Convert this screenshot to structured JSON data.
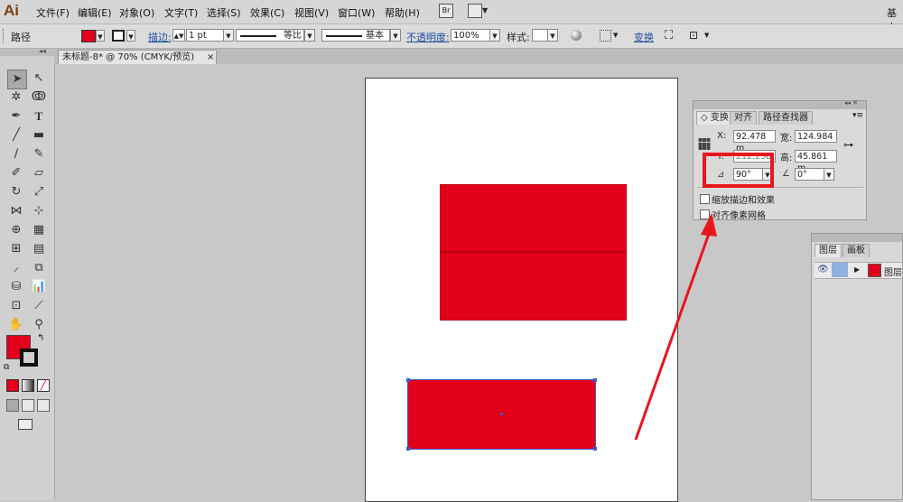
{
  "app": {
    "logo": "Ai"
  },
  "menu": {
    "items": [
      "文件(F)",
      "编辑(E)",
      "对象(O)",
      "文字(T)",
      "选择(S)",
      "效果(C)",
      "视图(V)",
      "窗口(W)",
      "帮助(H)"
    ],
    "bridge_label": "Br",
    "right_text": "基本"
  },
  "control": {
    "object_type": "路径",
    "fill_color": "#e3001b",
    "stroke_label": "描边:",
    "stroke_weight": "1 pt",
    "stroke_profile": "等比",
    "brush": "基本",
    "opacity_label": "不透明度:",
    "opacity_value": "100%",
    "style_label": "样式:",
    "transform_link": "变换"
  },
  "document": {
    "tab_title": "未标题-8* @ 70% (CMYK/预览)",
    "close": "×"
  },
  "canvas": {
    "artboard_color": "#ffffff",
    "shape_color": "#e3001b",
    "annotation_color": "#e8161d"
  },
  "transform_panel": {
    "tabs": [
      "变换",
      "对齐",
      "路径查找器"
    ],
    "x_label": "X:",
    "x_value": "92.478 m",
    "y_label": "Y:",
    "y_value": "212.258",
    "w_label": "宽:",
    "w_value": "124.984",
    "h_label": "高:",
    "h_value": "45.861 m",
    "rotate_value": "90°",
    "shear_value": "0°",
    "checkbox_scale_strokes": "缩放描边和效果",
    "checkbox_align_pixel": "对齐像素网格"
  },
  "layers_panel": {
    "tabs": [
      "图层",
      "画板"
    ],
    "layer_name": "图层"
  }
}
